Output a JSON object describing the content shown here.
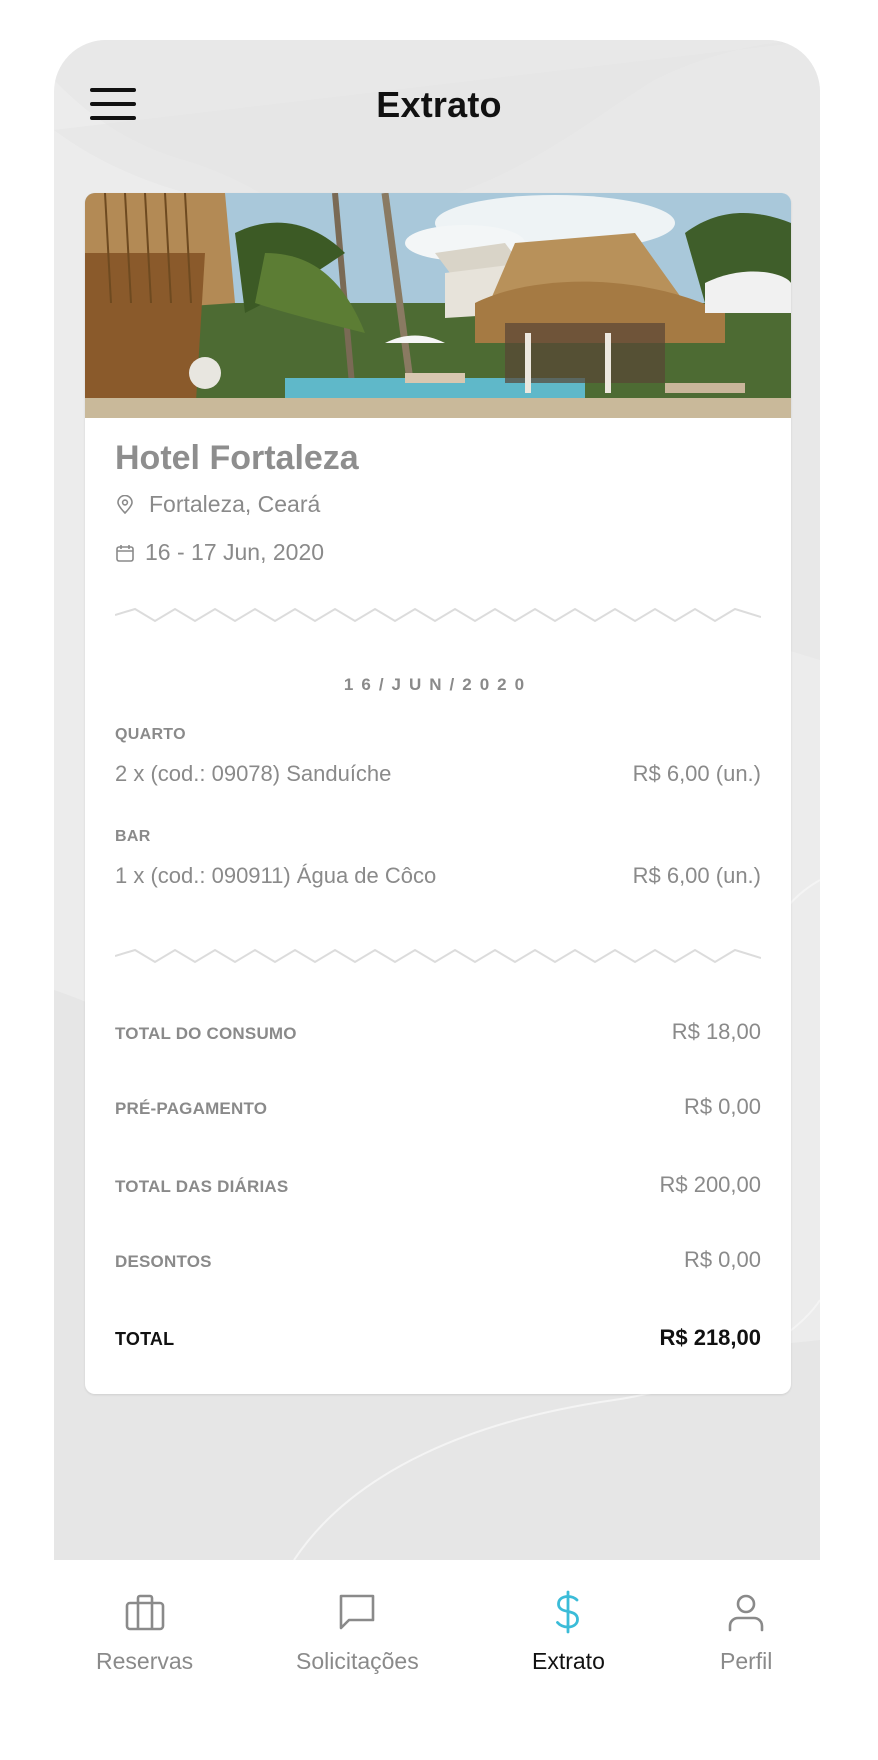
{
  "header": {
    "title": "Extrato",
    "menu_icon": "hamburger-menu-icon"
  },
  "hotel": {
    "name": "Hotel Fortaleza",
    "location": "Fortaleza, Ceará",
    "dates": "16 - 17 Jun, 2020",
    "location_icon": "map-pin-icon",
    "dates_icon": "calendar-icon"
  },
  "statement": {
    "date": "16/JUN/2020",
    "sections": [
      {
        "label": "QUARTO",
        "item": "2 x (cod.: 09078) Sanduíche",
        "price": "R$ 6,00 (un.)"
      },
      {
        "label": "BAR",
        "item": "1 x (cod.: 090911) Água de Côco",
        "price": "R$ 6,00 (un.)"
      }
    ]
  },
  "summary": {
    "consumo_label": "TOTAL DO CONSUMO",
    "consumo_value": "R$ 18,00",
    "prepagamento_label": "PRÉ-PAGAMENTO",
    "prepagamento_value": "R$ 0,00",
    "diarias_label": "TOTAL DAS DIÁRIAS",
    "diarias_value": "R$ 200,00",
    "descontos_label": "DESONTOS",
    "descontos_value": "R$ 0,00",
    "total_label": "TOTAL",
    "total_value": "R$ 218,00"
  },
  "tabs": [
    {
      "label": "Reservas",
      "icon": "briefcase-icon",
      "active": false
    },
    {
      "label": "Solicitações",
      "icon": "chat-bubble-icon",
      "active": false
    },
    {
      "label": "Extrato",
      "icon": "dollar-icon",
      "active": true
    },
    {
      "label": "Perfil",
      "icon": "user-icon",
      "active": false
    }
  ],
  "colors": {
    "accent": "#3bbcd8",
    "background": "#ececec",
    "text_muted": "#8a8a8a",
    "text_dark": "#111111"
  }
}
